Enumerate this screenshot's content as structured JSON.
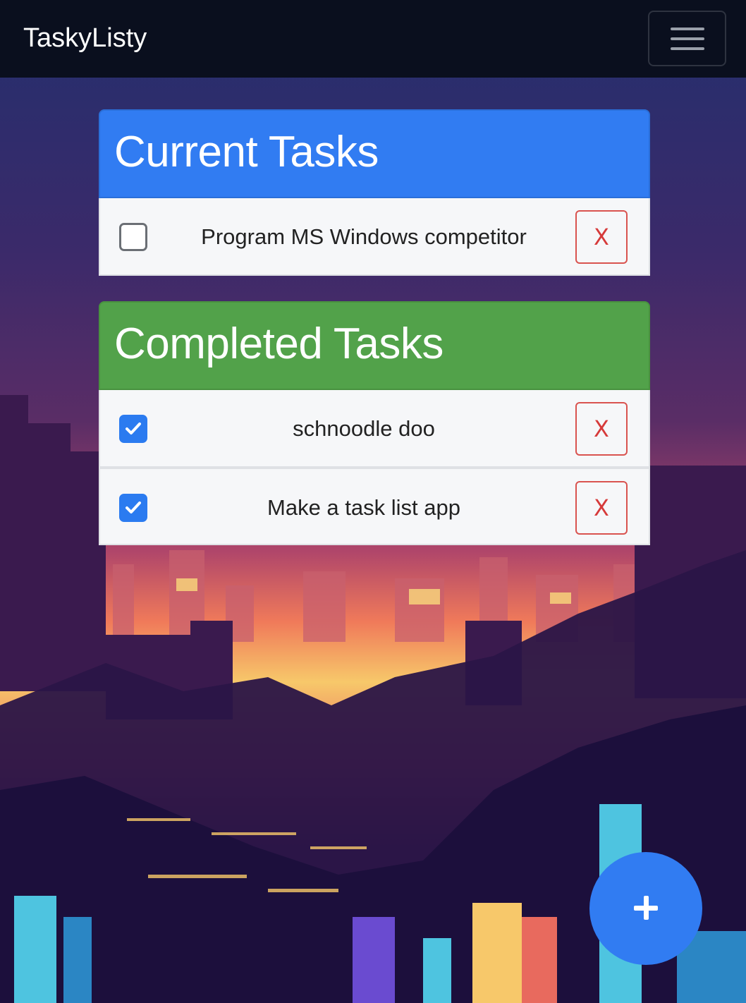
{
  "navbar": {
    "brand": "TaskyListy",
    "menu_icon": "hamburger-menu-icon"
  },
  "current": {
    "title": "Current Tasks",
    "color": "#317cf2",
    "tasks": [
      {
        "text": "Program MS Windows competitor",
        "checked": false,
        "delete_label": "X"
      }
    ]
  },
  "completed": {
    "title": "Completed Tasks",
    "color": "#52a24a",
    "tasks": [
      {
        "text": "schnoodle doo",
        "checked": true,
        "delete_label": "X"
      },
      {
        "text": "Make a task list app",
        "checked": true,
        "delete_label": "X"
      }
    ]
  },
  "fab": {
    "icon": "plus-icon"
  },
  "colors": {
    "navbar": "#0a0f1e",
    "delete": "#d63a3a",
    "checkbox_checked": "#2b7bf0"
  }
}
